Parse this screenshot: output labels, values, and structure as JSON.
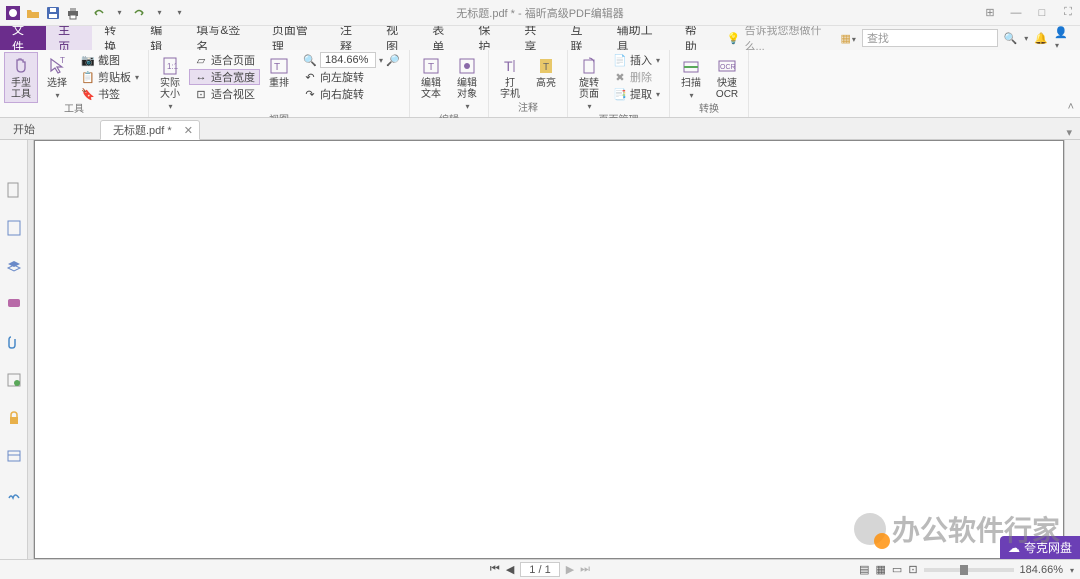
{
  "title": "无标题.pdf * - 福昕高级PDF编辑器",
  "qat": {
    "open": "打开",
    "save": "保存",
    "print": "打印",
    "undo": "撤销",
    "redo": "重做"
  },
  "menu": {
    "file": "文件",
    "home": "主页",
    "convert": "转换",
    "edit": "编辑",
    "fill": "填写&签名",
    "pageorg": "页面管理",
    "comment": "注释",
    "view": "视图",
    "form": "表单",
    "protect": "保护",
    "share": "共享",
    "connect": "互联",
    "access": "辅助工具",
    "help": "帮助",
    "tellme": "告诉我您想做什么...",
    "find": "查找"
  },
  "ribbon": {
    "tools": {
      "hand": "手型\n工具",
      "select": "选择",
      "snapshot": "截图",
      "clipboard": "剪贴板",
      "bookmark": "书签",
      "label": "工具"
    },
    "view": {
      "actual": "实际\n大小",
      "fitpage": "适合页面",
      "fitwidth": "适合宽度",
      "fitvisible": "适合视区",
      "reflow": "重排",
      "rotl": "向左旋转",
      "rotr": "向右旋转",
      "zoom": "184.66%",
      "label": "视图"
    },
    "edit": {
      "edittext": "编辑\n文本",
      "editobj": "编辑\n对象",
      "typewriter": "打\n字机",
      "highlight": "高亮",
      "label": "编辑"
    },
    "comment": {
      "label": "注释"
    },
    "pageorg": {
      "rotate": "旋转\n页面",
      "insert": "插入",
      "delete": "删除",
      "extract": "提取",
      "label": "页面管理"
    },
    "convert": {
      "scan": "扫描",
      "ocr": "快速\nOCR",
      "label": "转换"
    }
  },
  "tabs": {
    "start": "开始",
    "doc": "无标题.pdf *"
  },
  "status": {
    "page": "1 / 1",
    "zoom": "184.66%"
  },
  "quark": "夸克网盘",
  "watermark": "办公软件行家"
}
